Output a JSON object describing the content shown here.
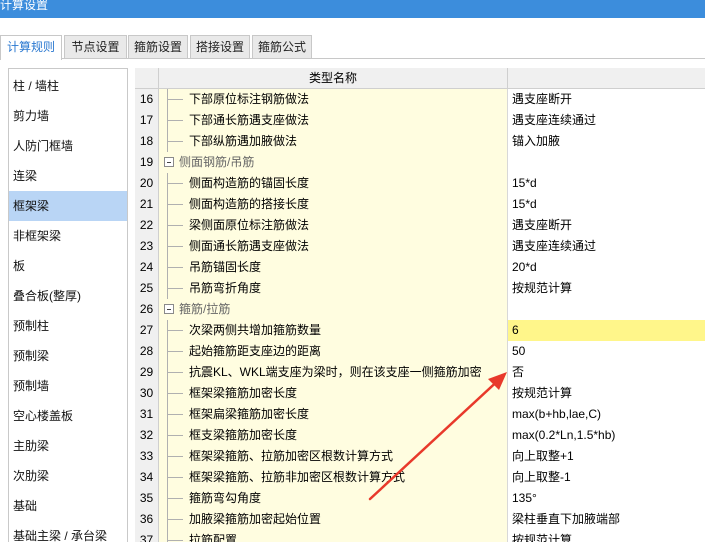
{
  "window": {
    "title": "计算设置"
  },
  "tabs": [
    {
      "label": "计算规则",
      "active": true
    },
    {
      "label": "节点设置",
      "active": false
    },
    {
      "label": "箍筋设置",
      "active": false
    },
    {
      "label": "搭接设置",
      "active": false
    },
    {
      "label": "箍筋公式",
      "active": false
    }
  ],
  "sidebar": {
    "selected": "框架梁",
    "items": [
      {
        "label": "柱 / 墙柱"
      },
      {
        "label": "剪力墙"
      },
      {
        "label": "人防门框墙"
      },
      {
        "label": "连梁"
      },
      {
        "label": "框架梁"
      },
      {
        "label": "非框架梁"
      },
      {
        "label": "板"
      },
      {
        "label": "叠合板(整厚)"
      },
      {
        "label": "预制柱"
      },
      {
        "label": "预制梁"
      },
      {
        "label": "预制墙"
      },
      {
        "label": "空心楼盖板"
      },
      {
        "label": "主肋梁"
      },
      {
        "label": "次肋梁"
      },
      {
        "label": "基础"
      },
      {
        "label": "基础主梁 / 承台梁"
      }
    ]
  },
  "grid": {
    "header": {
      "name": "类型名称",
      "value": ""
    },
    "rows": [
      {
        "num": "16",
        "name": "下部原位标注钢筋做法",
        "value": "遇支座断开",
        "group": false
      },
      {
        "num": "17",
        "name": "下部通长筋遇支座做法",
        "value": "遇支座连续通过",
        "group": false
      },
      {
        "num": "18",
        "name": "下部纵筋遇加腋做法",
        "value": "锚入加腋",
        "group": false
      },
      {
        "num": "19",
        "name": "侧面钢筋/吊筋",
        "value": "",
        "group": true
      },
      {
        "num": "20",
        "name": "侧面构造筋的锚固长度",
        "value": "15*d",
        "group": false
      },
      {
        "num": "21",
        "name": "侧面构造筋的搭接长度",
        "value": "15*d",
        "group": false
      },
      {
        "num": "22",
        "name": "梁侧面原位标注筋做法",
        "value": "遇支座断开",
        "group": false
      },
      {
        "num": "23",
        "name": "侧面通长筋遇支座做法",
        "value": "遇支座连续通过",
        "group": false
      },
      {
        "num": "24",
        "name": "吊筋锚固长度",
        "value": "20*d",
        "group": false
      },
      {
        "num": "25",
        "name": "吊筋弯折角度",
        "value": "按规范计算",
        "group": false
      },
      {
        "num": "26",
        "name": "箍筋/拉筋",
        "value": "",
        "group": true
      },
      {
        "num": "27",
        "name": "次梁两侧共增加箍筋数量",
        "value": "6",
        "group": false,
        "highlight": true
      },
      {
        "num": "28",
        "name": "起始箍筋距支座边的距离",
        "value": "50",
        "group": false
      },
      {
        "num": "29",
        "name": "抗震KL、WKL端支座为梁时，则在该支座一侧箍筋加密",
        "value": "否",
        "group": false
      },
      {
        "num": "30",
        "name": "框架梁箍筋加密长度",
        "value": "按规范计算",
        "group": false
      },
      {
        "num": "31",
        "name": "框架扁梁箍筋加密长度",
        "value": "max(b+hb,lae,C)",
        "group": false
      },
      {
        "num": "32",
        "name": "框支梁箍筋加密长度",
        "value": "max(0.2*Ln,1.5*hb)",
        "group": false
      },
      {
        "num": "33",
        "name": "框架梁箍筋、拉筋加密区根数计算方式",
        "value": "向上取整+1",
        "group": false
      },
      {
        "num": "34",
        "name": "框架梁箍筋、拉筋非加密区根数计算方式",
        "value": "向上取整-1",
        "group": false
      },
      {
        "num": "35",
        "name": "箍筋弯勾角度",
        "value": "135°",
        "group": false
      },
      {
        "num": "36",
        "name": "加腋梁箍筋加密起始位置",
        "value": "梁柱垂直下加腋端部",
        "group": false
      },
      {
        "num": "37",
        "name": "拉筋配置",
        "value": "按规范计算",
        "group": false
      }
    ]
  },
  "annotation": {
    "type": "arrow",
    "color": "#e8392b"
  },
  "colors": {
    "title_bar": "#3c8ddc",
    "selected_item": "#b9d5f5",
    "name_cell": "#fffde0",
    "highlight_cell": "#fff68a"
  }
}
